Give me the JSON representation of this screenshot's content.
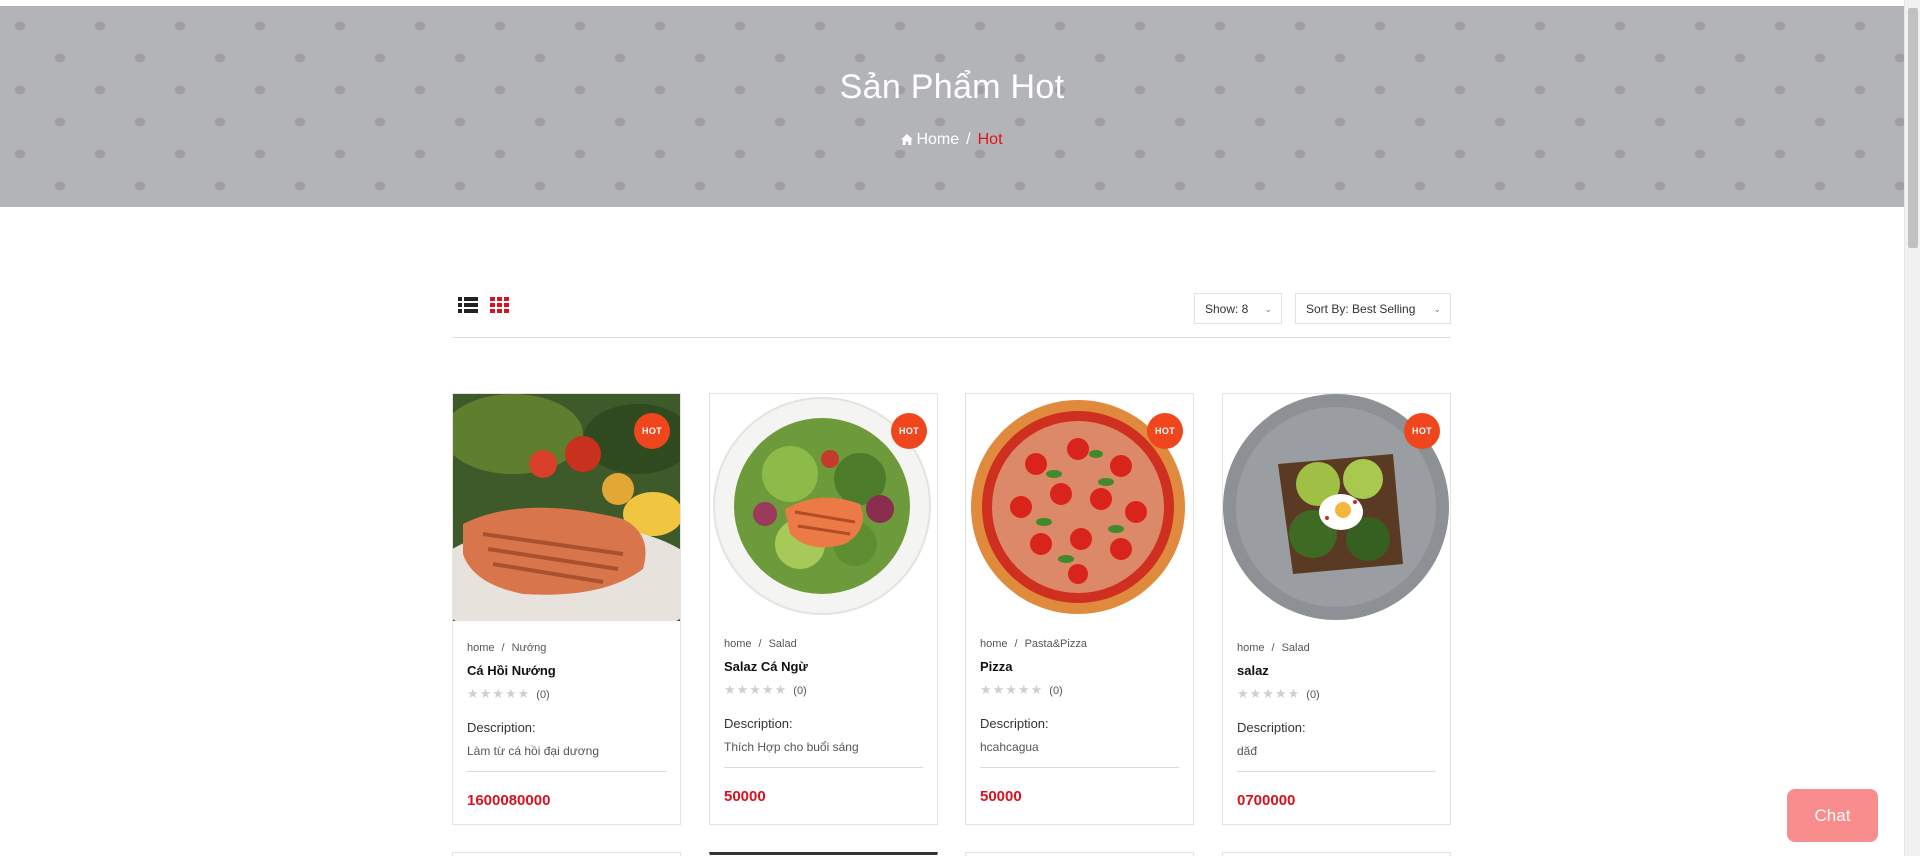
{
  "banner": {
    "title": "Sản Phẩm Hot",
    "breadcrumb": {
      "home": "Home",
      "separator": "/",
      "current": "Hot"
    }
  },
  "toolbar": {
    "show_label": "Show: 8",
    "sort_label": "Sort By: Best Selling",
    "caret": "⌄"
  },
  "products": [
    {
      "badge": "HOT",
      "crumb_home": "home",
      "crumb_sep": "/",
      "category": "Nướng",
      "name": "Cá Hồi Nướng",
      "stars": "★★★★★",
      "review_count": "(0)",
      "desc_label": "Description:",
      "description": "Làm từ cá hồi đại dương",
      "price": "1600080000"
    },
    {
      "badge": "HOT",
      "crumb_home": "home",
      "crumb_sep": "/",
      "category": "Salad",
      "name": "Salaz Cá Ngừ",
      "stars": "★★★★★",
      "review_count": "(0)",
      "desc_label": "Description:",
      "description": "Thích Hợp cho buổi sáng",
      "price": "50000"
    },
    {
      "badge": "HOT",
      "crumb_home": "home",
      "crumb_sep": "/",
      "category": "Pasta&Pizza",
      "name": "Pizza",
      "stars": "★★★★★",
      "review_count": "(0)",
      "desc_label": "Description:",
      "description": "hcahcagua",
      "price": "50000"
    },
    {
      "badge": "HOT",
      "crumb_home": "home",
      "crumb_sep": "/",
      "category": "Salad",
      "name": "salaz",
      "stars": "★★★★★",
      "review_count": "(0)",
      "desc_label": "Description:",
      "description": "dăđ",
      "price": "0700000"
    }
  ],
  "chat": {
    "label": "Chat"
  },
  "colors": {
    "accent": "#e3131b",
    "price": "#d81220",
    "hot_badge": "#f0461e",
    "chat": "#f98c8c",
    "banner": "#b3b4b8"
  },
  "icons": [
    "home-icon",
    "list-view-icon",
    "grid-view-icon",
    "chevron-down-icon"
  ]
}
